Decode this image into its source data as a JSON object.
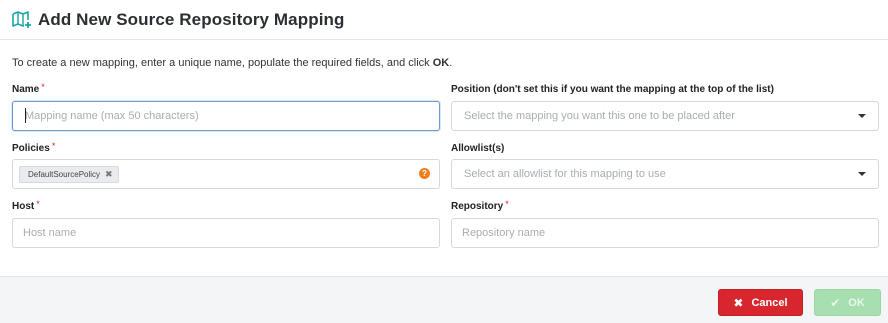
{
  "dialog": {
    "title": "Add New Source Repository Mapping",
    "icon": "map-plus-icon"
  },
  "instructions": {
    "prefix": "To create a new mapping, enter a unique name, populate the required fields, and click ",
    "emphasis": "OK",
    "suffix": "."
  },
  "fields": {
    "name": {
      "label": "Name",
      "required_mark": "*",
      "value": "",
      "placeholder": "Mapping name (max 50 characters)"
    },
    "position": {
      "label": "Position (don't set this if you want the mapping at the top of the list)",
      "placeholder": "Select the mapping you want this one to be placed after"
    },
    "policies": {
      "label": "Policies",
      "required_mark": "*",
      "chips": [
        "DefaultSourcePolicy"
      ],
      "help_glyph": "?"
    },
    "allowlists": {
      "label": "Allowlist(s)",
      "placeholder": "Select an allowlist for this mapping to use"
    },
    "host": {
      "label": "Host",
      "required_mark": "*",
      "value": "",
      "placeholder": "Host name"
    },
    "repository": {
      "label": "Repository",
      "required_mark": "*",
      "value": "",
      "placeholder": "Repository name"
    }
  },
  "footer": {
    "cancel_label": "Cancel",
    "cancel_glyph": "✖",
    "ok_label": "OK",
    "ok_glyph": "✔"
  },
  "colors": {
    "accent_teal": "#1aa6a6",
    "cancel_red": "#d7262e",
    "ok_disabled_green": "#a7dfb0",
    "required_red": "#d9272e",
    "help_orange": "#f07f1e",
    "focus_blue": "#6f9ad1"
  }
}
